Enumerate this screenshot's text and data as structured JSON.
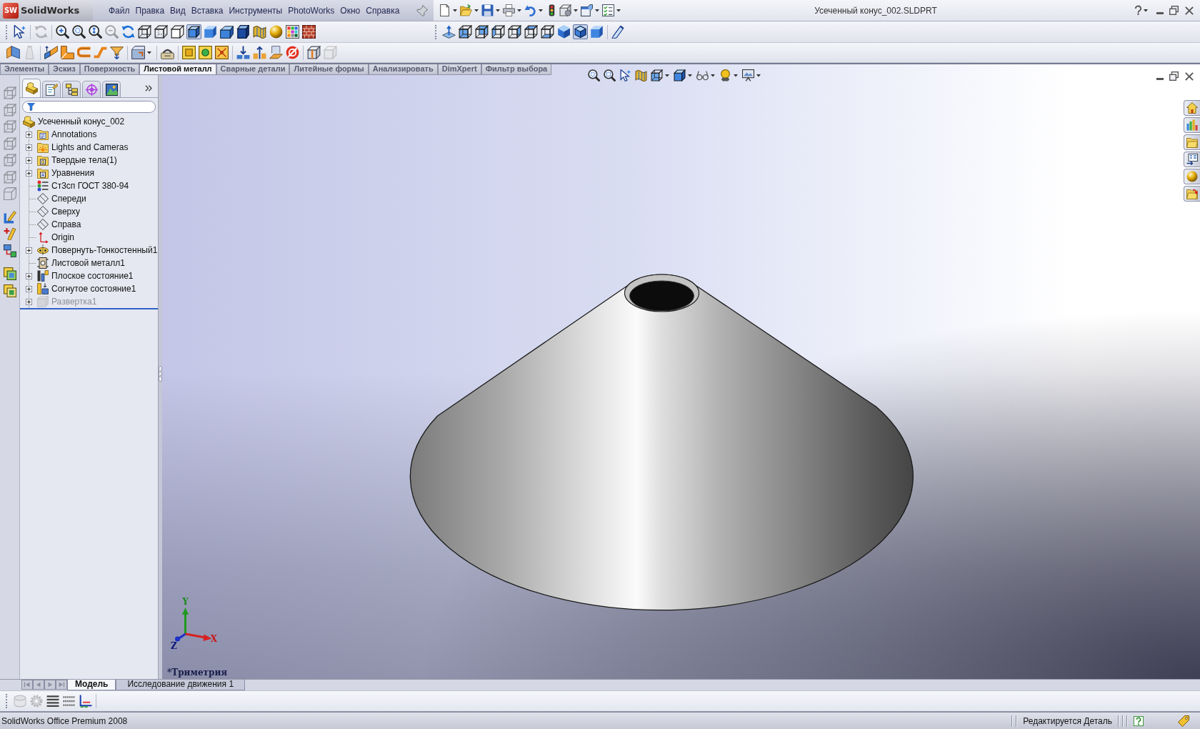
{
  "title_bar": {
    "logo_badge": "SW",
    "logo_text": "SolidWorks",
    "menu": [
      "Файл",
      "Правка",
      "Вид",
      "Вставка",
      "Инструменты",
      "PhotoWorks",
      "Окно",
      "Справка"
    ],
    "document_title": "Усеченный конус_002.SLDPRT"
  },
  "view_toolbar": {
    "buttons": [
      {
        "selected": false,
        "disabled": false
      },
      {
        "selected": false,
        "disabled": true
      },
      {
        "selected": false,
        "disabled": false
      },
      {
        "selected": false,
        "disabled": false
      },
      {
        "selected": false,
        "disabled": false
      },
      {
        "selected": false,
        "disabled": true
      },
      {
        "selected": false,
        "disabled": false
      },
      {
        "selected": false,
        "disabled": false
      },
      {
        "selected": false,
        "disabled": false
      },
      {
        "selected": false,
        "disabled": false
      },
      {
        "selected": true,
        "disabled": false
      },
      {
        "selected": false,
        "disabled": false
      },
      {
        "selected": false,
        "disabled": false
      },
      {
        "selected": false,
        "disabled": false
      },
      {
        "selected": false,
        "disabled": false
      },
      {
        "selected": false,
        "disabled": false
      },
      {
        "selected": false,
        "disabled": false
      },
      {
        "selected": false,
        "disabled": false
      }
    ]
  },
  "standard_views_toolbar": {
    "buttons": [
      {
        "selected": false
      },
      {
        "selected": false
      },
      {
        "selected": false
      },
      {
        "selected": false
      },
      {
        "selected": false
      },
      {
        "selected": false
      },
      {
        "selected": false
      },
      {
        "selected": false
      },
      {
        "selected": true
      },
      {
        "selected": false
      },
      {
        "selected": false
      }
    ]
  },
  "sheet_metal_toolbar": {
    "buttons": [
      {
        "disabled": false
      },
      {
        "disabled": true
      },
      {
        "disabled": false
      },
      {
        "disabled": false
      },
      {
        "disabled": false
      },
      {
        "disabled": false
      },
      {
        "disabled": false
      },
      {
        "disabled": false
      },
      {
        "disabled": false
      },
      {
        "disabled": false
      },
      {
        "disabled": false
      },
      {
        "disabled": false
      },
      {
        "disabled": false
      },
      {
        "disabled": false
      },
      {
        "disabled": false
      },
      {
        "disabled": false
      },
      {
        "disabled": false
      },
      {
        "disabled": true
      }
    ]
  },
  "command_tabs": [
    {
      "label": "Элементы",
      "selected": false
    },
    {
      "label": "Эскиз",
      "selected": false
    },
    {
      "label": "Поверхность",
      "selected": false
    },
    {
      "label": "Листовой металл",
      "selected": true
    },
    {
      "label": "Сварные детали",
      "selected": false
    },
    {
      "label": "Литейные формы",
      "selected": false
    },
    {
      "label": "Анализировать",
      "selected": false
    },
    {
      "label": "DimXpert",
      "selected": false
    },
    {
      "label": "Фильтр выбора",
      "selected": false
    }
  ],
  "left_toolbar": {
    "buttons": [
      {
        "disabled": true
      },
      {
        "disabled": true
      },
      {
        "disabled": true
      },
      {
        "disabled": true
      },
      {
        "disabled": true
      },
      {
        "disabled": true
      },
      {
        "disabled": true
      },
      {
        "disabled": false
      },
      {
        "disabled": false
      },
      {
        "disabled": false
      },
      {
        "disabled": false
      },
      {
        "disabled": false
      }
    ]
  },
  "feature_manager": {
    "tabs": [
      {
        "selected": true
      },
      {
        "selected": false
      },
      {
        "selected": false
      },
      {
        "selected": false
      },
      {
        "selected": false
      }
    ],
    "tree": {
      "label": "Усеченный конус_002",
      "children": [
        {
          "label": "Annotations",
          "kind": "annotations",
          "expanded": false,
          "suppressed": false
        },
        {
          "label": "Lights and Cameras",
          "kind": "lights",
          "expanded": false,
          "suppressed": false
        },
        {
          "label": "Твердые тела(1)",
          "kind": "solid_bodies",
          "expanded": false,
          "suppressed": false
        },
        {
          "label": "Уравнения",
          "kind": "equations",
          "expanded": false,
          "suppressed": false
        },
        {
          "label": "Ст3сп ГОСТ 380-94",
          "kind": "material",
          "suppressed": false
        },
        {
          "label": "Спереди",
          "kind": "plane",
          "suppressed": false
        },
        {
          "label": "Сверху",
          "kind": "plane",
          "suppressed": false
        },
        {
          "label": "Справа",
          "kind": "plane",
          "suppressed": false
        },
        {
          "label": "Origin",
          "kind": "origin",
          "suppressed": false
        },
        {
          "label": "Повернуть-Тонкостенный1",
          "kind": "revolve",
          "expanded": false,
          "suppressed": false
        },
        {
          "label": "Листовой металл1",
          "kind": "sheet_metal",
          "suppressed": false
        },
        {
          "label": "Плоское состояние1",
          "kind": "flat",
          "expanded": false,
          "suppressed": false
        },
        {
          "label": "Согнутое состояние1",
          "kind": "bent",
          "expanded": false,
          "suppressed": false
        },
        {
          "label": "Развертка1",
          "kind": "flatten",
          "expanded": false,
          "suppressed": true
        }
      ]
    }
  },
  "viewport": {
    "view_name": "*Триметрия",
    "triad": {
      "x": "X",
      "y": "Y",
      "z": "Z"
    }
  },
  "bottom_tabs": [
    {
      "label": "Модель",
      "selected": true
    },
    {
      "label": "Исследование движения 1",
      "selected": false
    }
  ],
  "motion_toolbar": {
    "buttons": [
      {
        "disabled": true
      },
      {
        "disabled": true
      },
      {
        "disabled": false
      },
      {
        "disabled": false
      },
      {
        "disabled": false
      }
    ]
  },
  "status_bar": {
    "product": "SolidWorks Office Premium 2008",
    "mode": "Редактируется Деталь"
  }
}
